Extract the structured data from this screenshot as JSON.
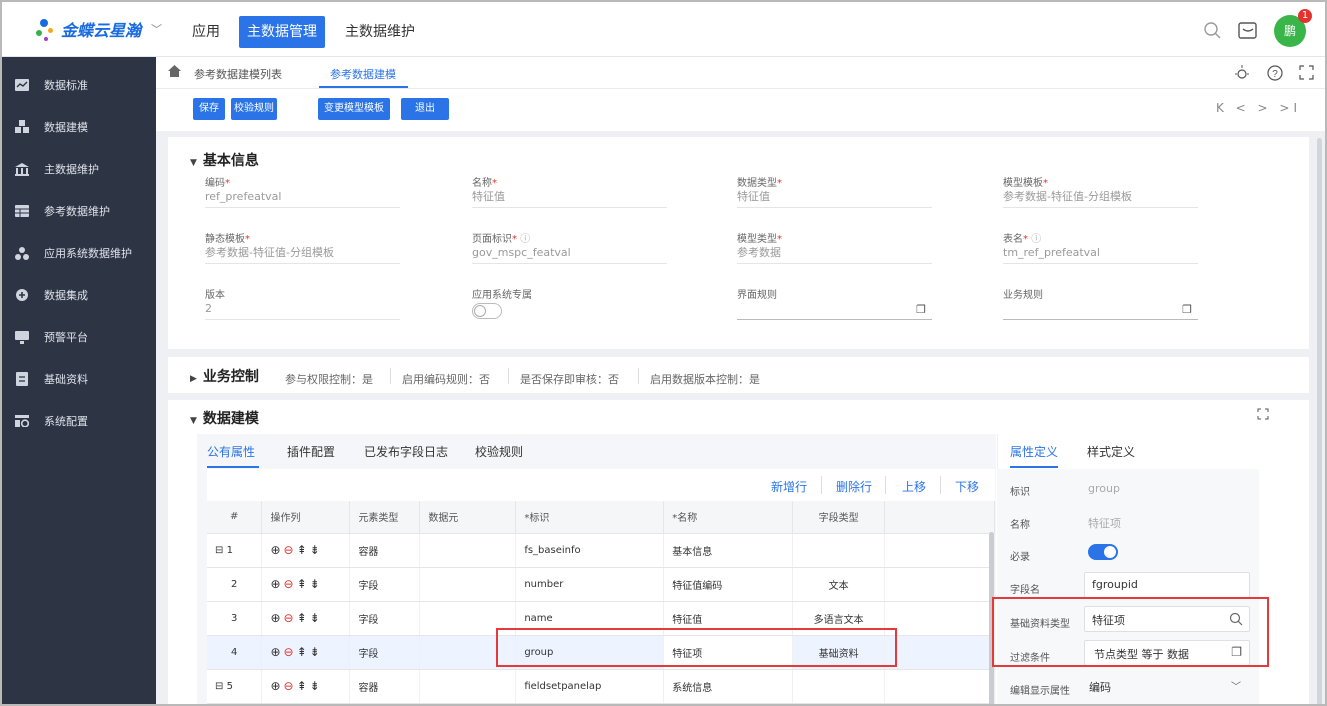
{
  "topbar": {
    "brand": "金蝶云星瀚",
    "nav_app": "应用",
    "nav_mdm": "主数据管理",
    "nav_mdm_maintain": "主数据维护",
    "avatar_text": "鹏",
    "badge_count": "1"
  },
  "sidebar": {
    "items": [
      {
        "label": "数据标准",
        "icon": "chart-icon"
      },
      {
        "label": "数据建模",
        "icon": "model-icon"
      },
      {
        "label": "主数据维护",
        "icon": "building-icon"
      },
      {
        "label": "参考数据维护",
        "icon": "table-icon"
      },
      {
        "label": "应用系统数据维护",
        "icon": "cluster-icon"
      },
      {
        "label": "数据集成",
        "icon": "integrate-icon"
      },
      {
        "label": "预警平台",
        "icon": "monitor-icon"
      },
      {
        "label": "基础资料",
        "icon": "doc-icon"
      },
      {
        "label": "系统配置",
        "icon": "config-icon"
      }
    ]
  },
  "breadcrumb": {
    "item1": "参考数据建模列表",
    "item2": "参考数据建模"
  },
  "toolbar": {
    "save": "保存",
    "check": "校验规则",
    "change": "变更模型模板",
    "exit": "退出",
    "pager": "K < > >I"
  },
  "basic": {
    "title": "基本信息",
    "fields": [
      {
        "label": "编码",
        "req": "*",
        "value": "ref_prefeatval"
      },
      {
        "label": "名称",
        "req": "*",
        "value": "特征值"
      },
      {
        "label": "数据类型",
        "req": "*",
        "value": "特征值"
      },
      {
        "label": "模型模板",
        "req": "*",
        "value": "参考数据-特征值-分组模板"
      },
      {
        "label": "静态模板",
        "req": "*",
        "value": "参考数据-特征值-分组模板"
      },
      {
        "label": "页面标识",
        "req": "*",
        "value": "gov_mspc_featval"
      },
      {
        "label": "模型类型",
        "req": "*",
        "value": "参考数据"
      },
      {
        "label": "表名",
        "req": "*",
        "value": "tm_ref_prefeatval"
      },
      {
        "label": "版本",
        "req": "",
        "value": "2"
      },
      {
        "label": "应用系统专属",
        "req": "",
        "value": ""
      },
      {
        "label": "界面规则",
        "req": "",
        "value": ""
      },
      {
        "label": "业务规则",
        "req": "",
        "value": ""
      }
    ]
  },
  "business": {
    "title": "业务控制",
    "items": [
      "参与权限控制：是",
      "启用编码规则：否",
      "是否保存即审核：否",
      "启用数据版本控制：是"
    ]
  },
  "modeling": {
    "title": "数据建模",
    "tabs": [
      "公有属性",
      "插件配置",
      "已发布字段日志",
      "校验规则"
    ],
    "actions": [
      "新增行",
      "删除行",
      "上移",
      "下移"
    ],
    "columns": [
      "#",
      "操作列",
      "元素类型",
      "数据元",
      "*标识",
      "*名称",
      "字段类型"
    ],
    "rows": [
      {
        "no": "1",
        "type": "容器",
        "key": "fs_baseinfo",
        "name": "基本信息",
        "ftype": "",
        "expand": "⊟"
      },
      {
        "no": "2",
        "type": "字段",
        "key": "number",
        "name": "特征值编码",
        "ftype": "文本",
        "expand": ""
      },
      {
        "no": "3",
        "type": "字段",
        "key": "name",
        "name": "特征值",
        "ftype": "多语言文本",
        "expand": ""
      },
      {
        "no": "4",
        "type": "字段",
        "key": "group",
        "name": "特征项",
        "ftype": "基础资料",
        "expand": ""
      },
      {
        "no": "5",
        "type": "容器",
        "key": "fieldsetpanelap",
        "name": "系统信息",
        "ftype": "",
        "expand": "⊟"
      }
    ],
    "prop_tabs": [
      "属性定义",
      "样式定义"
    ],
    "props": {
      "id_label": "标识",
      "id_value": "group",
      "name_label": "名称",
      "name_value": "特征项",
      "required_label": "必录",
      "field_label": "字段名",
      "field_value": "fgroupid",
      "basetype_label": "基础资料类型",
      "basetype_value": "特征项",
      "filter_label": "过滤条件",
      "filter_value": "节点类型 等于 数据",
      "display_label": "编辑显示属性",
      "display_value": "编码"
    }
  }
}
